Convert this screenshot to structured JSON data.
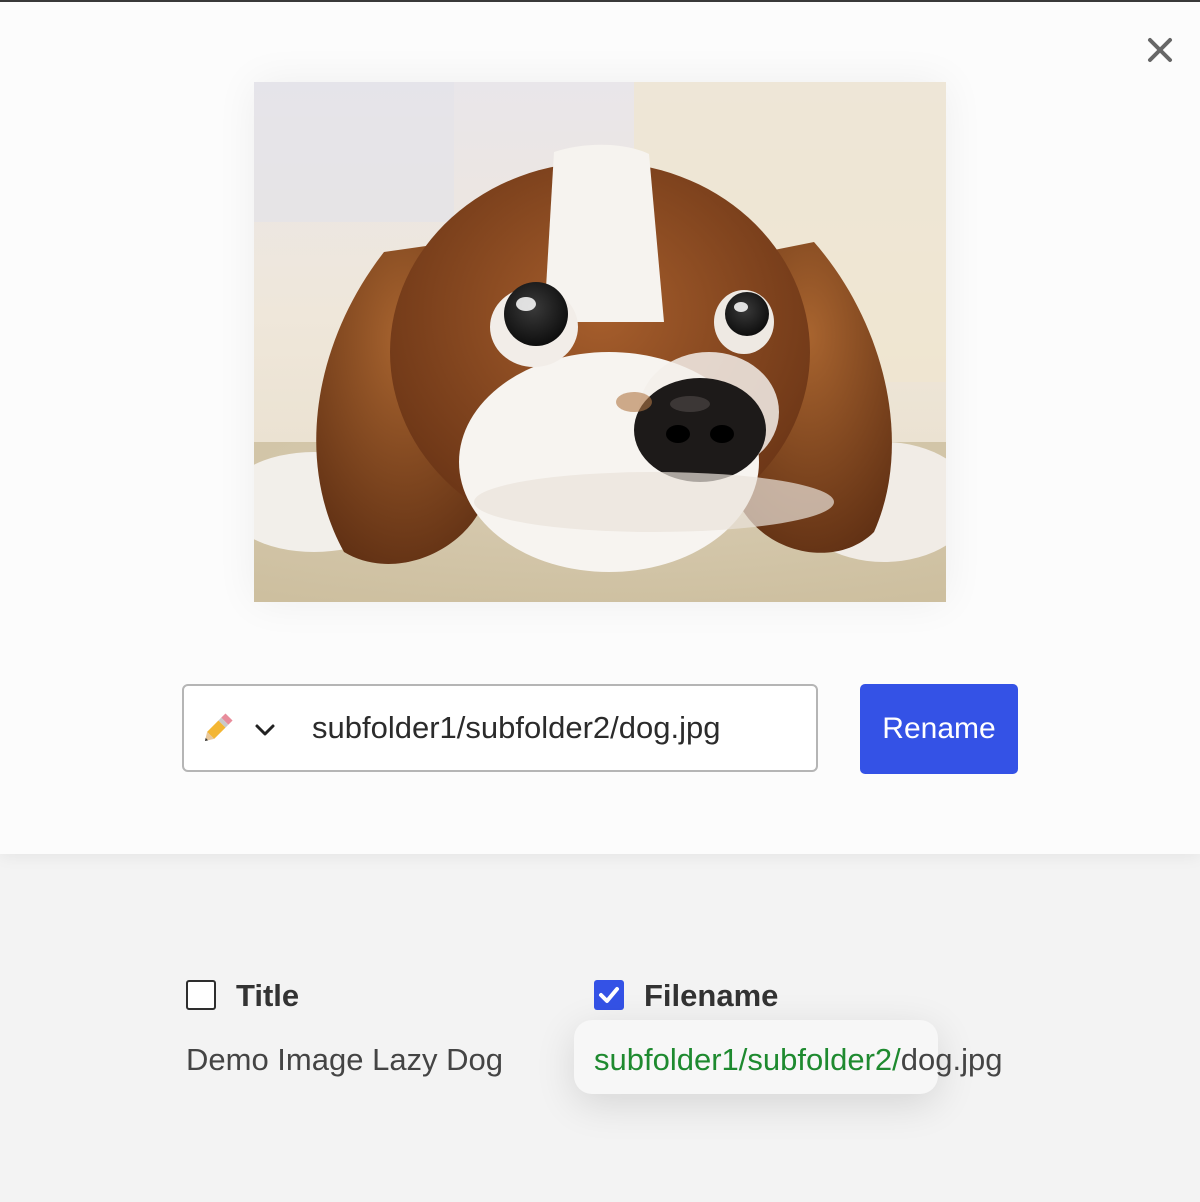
{
  "dialog": {
    "close_icon": "close-icon",
    "image_alt": "Cavalier King Charles spaniel puppy lying on carpet"
  },
  "rename": {
    "mode_icon": "pencil-icon",
    "dropdown_icon": "chevron-down-icon",
    "value": "subfolder1/subfolder2/dog.jpg",
    "button_label": "Rename"
  },
  "columns": {
    "title": {
      "label": "Title",
      "checked": false,
      "value": "Demo Image Lazy Dog"
    },
    "filename": {
      "label": "Filename",
      "checked": true,
      "path": "subfolder1/subfolder2/",
      "name": "dog.jpg"
    }
  },
  "colors": {
    "accent": "#3452e6",
    "path_highlight": "#1e8a2f"
  }
}
